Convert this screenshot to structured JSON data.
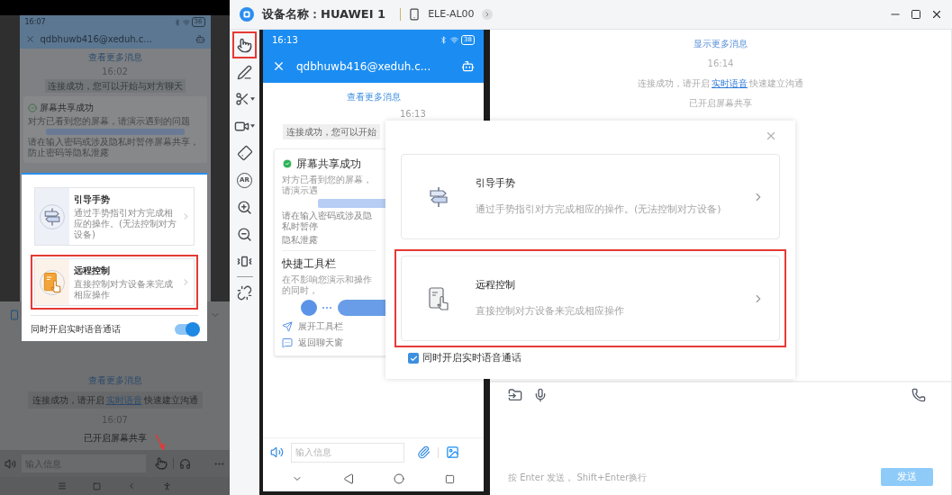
{
  "left_phone": {
    "status_time": "16:07",
    "battery": "36",
    "header_title": "qdbhuwb416@xeduh.c...",
    "more_link": "查看更多消息",
    "time": "16:02",
    "chip": "连接成功，您可以开始与对方聊天",
    "share_card": {
      "title": "屏幕共享成功",
      "text": "对方已看到您的屏幕，请演示遇到的问题",
      "note": "请在输入密码或涉及隐私时暂停屏幕共享，防止密码等隐私泄露"
    },
    "sheet": {
      "more_link": "查看更多消息",
      "message": {
        "before": "连接成功，请开启",
        "link": "实时语音",
        "after": "快速建立沟通"
      },
      "time": "16:07",
      "event": "已开启屏幕共享"
    },
    "input": {
      "placeholder": "输入信息",
      "gesture_pointed_at": true
    },
    "dialog": {
      "options": [
        {
          "kind": "gesture",
          "title": "引导手势",
          "description": "通过手势指引对方完成相应的操作。(无法控制对方设备)",
          "highlighted": false
        },
        {
          "kind": "remote",
          "title": "远程控制",
          "description": "直接控制对方设备来完成相应操作",
          "highlighted": true
        }
      ],
      "voice_toggle": {
        "label": "同时开启实时语音通话",
        "on": true
      }
    }
  },
  "window": {
    "title": "设备名称：HUAWEI 1",
    "model": "ELE-AL00"
  },
  "toolbar": [
    {
      "kind": "gesture",
      "highlighted": true,
      "dropdown": false
    },
    {
      "kind": "pen",
      "highlighted": false,
      "dropdown": false
    },
    {
      "kind": "scissors",
      "highlighted": false,
      "dropdown": true
    },
    {
      "kind": "video",
      "highlighted": false,
      "dropdown": true
    },
    {
      "kind": "rotate",
      "highlighted": false,
      "dropdown": false
    },
    {
      "kind": "ar",
      "label": "AR",
      "highlighted": false,
      "dropdown": false
    },
    {
      "kind": "zoom_in",
      "highlighted": false,
      "dropdown": false
    },
    {
      "kind": "zoom_out",
      "highlighted": false,
      "dropdown": false
    },
    {
      "kind": "vibrate",
      "highlighted": false,
      "dropdown": false
    },
    {
      "kind": "separator"
    },
    {
      "kind": "unlink",
      "highlighted": false,
      "dropdown": false
    }
  ],
  "mirror": {
    "status_time": "16:13",
    "battery": "38",
    "header_title": "qdbhuwb416@xeduh.c...",
    "more_link": "查看更多消息",
    "time": "16:13",
    "chip": "连接成功，您可以开始",
    "share_card": {
      "title": "屏幕共享成功",
      "text": "对方已看到您的屏幕，请演示遇",
      "note": "请在输入密码或涉及隐私时暂停",
      "note_2": "隐私泄露"
    },
    "quick_toolbar": {
      "title": "快捷工具栏",
      "text": "在不影响您演示和操作的同时，",
      "items": [
        "展开工具栏",
        "返回聊天窗"
      ]
    },
    "input_placeholder": "输入信息"
  },
  "chat": {
    "more_link": "显示更多消息",
    "time": "16:14",
    "message": {
      "before": "连接成功，请开启",
      "link": "实时语音",
      "after": "快速建立沟通"
    },
    "event": "已开启屏幕共享",
    "hint": "按 Enter 发送， Shift+Enter换行",
    "send": "发送",
    "send_disabled": true
  },
  "dialog": {
    "options": [
      {
        "kind": "gesture",
        "title": "引导手势",
        "description": "通过手势指引对方完成相应的操作。(无法控制对方设备)",
        "highlighted": false
      },
      {
        "kind": "remote",
        "title": "远程控制",
        "description": "直接控制对方设备来完成相应操作",
        "highlighted": true
      }
    ],
    "voice_checkbox": {
      "label": "同时开启实时语音通话",
      "checked": true
    }
  }
}
